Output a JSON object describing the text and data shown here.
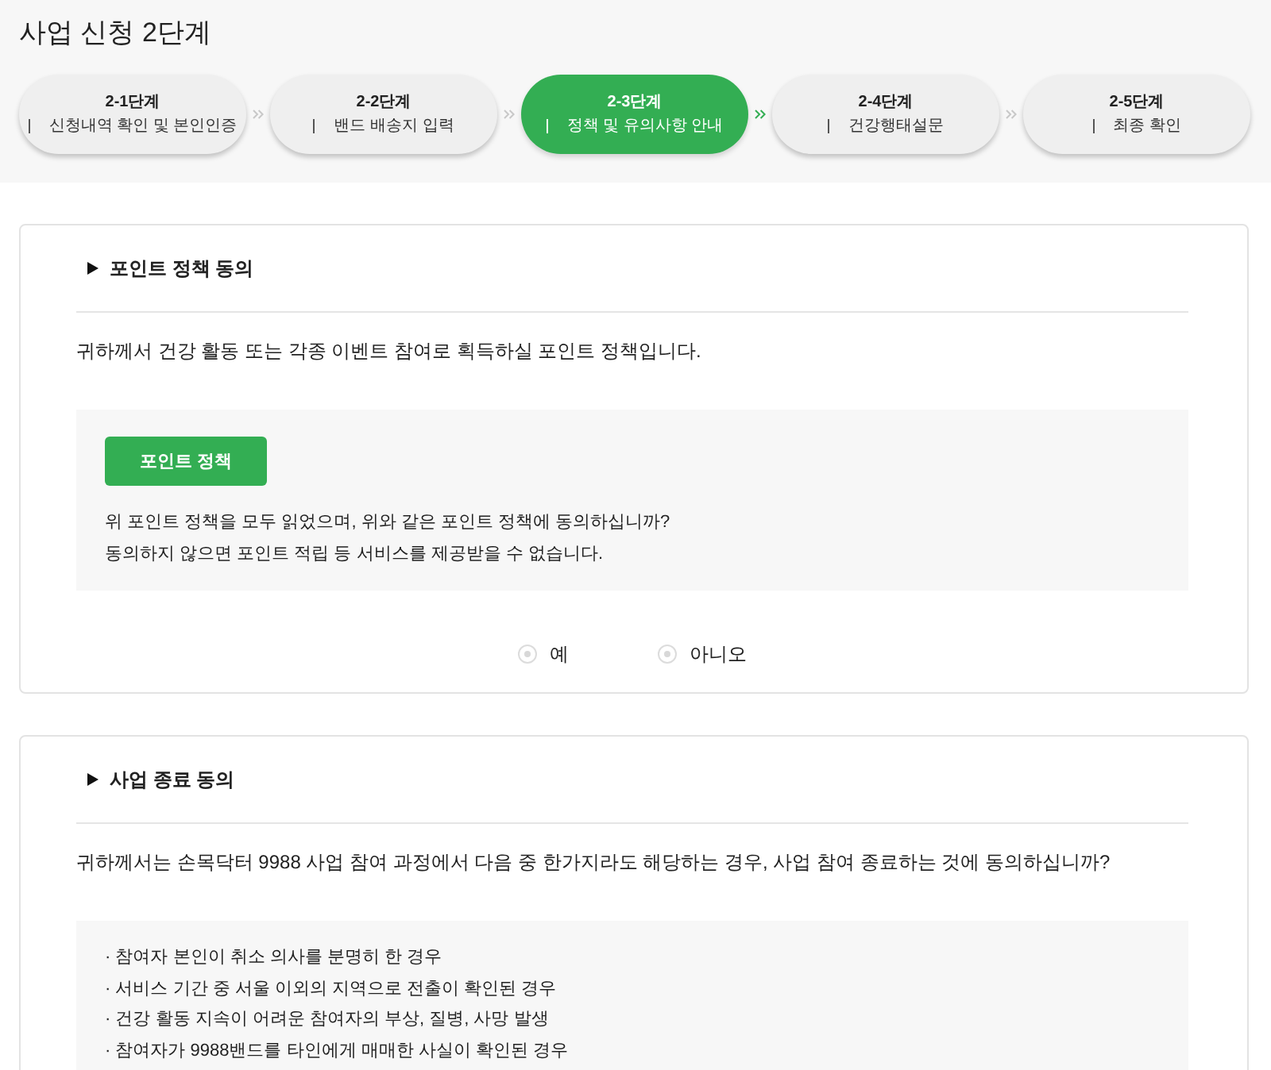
{
  "page": {
    "title": "사업 신청 2단계"
  },
  "steps": [
    {
      "step": "2-1단계",
      "label": "신청내역 확인 및 본인인증",
      "selected": false
    },
    {
      "step": "2-2단계",
      "label": "밴드 배송지 입력",
      "selected": false
    },
    {
      "step": "2-3단계",
      "label": "정책 및 유의사항 안내",
      "selected": true
    },
    {
      "step": "2-4단계",
      "label": "건강행태설문",
      "selected": false
    },
    {
      "step": "2-5단계",
      "label": "최종 확인",
      "selected": false
    }
  ],
  "sections": [
    {
      "title": "포인트 정책 동의",
      "description": "귀하께서 건강 활동 또는 각종 이벤트 참여로 획득하실 포인트 정책입니다.",
      "panel": {
        "button": "포인트 정책",
        "lines": [
          "위 포인트 정책을 모두 읽었으며, 위와 같은 포인트 정책에 동의하십니까?",
          "동의하지 않으면 포인트 적립 등 서비스를 제공받을 수 없습니다."
        ]
      },
      "options": [
        {
          "label": "예",
          "selected": false
        },
        {
          "label": "아니오",
          "selected": false
        }
      ]
    },
    {
      "title": "사업 종료 동의",
      "description": "귀하께서는 손목닥터 9988 사업 참여 과정에서 다음 중 한가지라도 해당하는 경우, 사업 참여 종료하는 것에 동의하십니까?",
      "panel": {
        "lines": [
          "· 참여자 본인이 취소 의사를 분명히 한 경우",
          "· 서비스 기간 중 서울 이외의 지역으로 전출이 확인된 경우",
          "· 건강 활동 지속이 어려운 참여자의 부상, 질병, 사망 발생",
          "· 참여자가 9988밴드를 타인에게 매매한 사실이 확인된 경우"
        ]
      }
    }
  ]
}
